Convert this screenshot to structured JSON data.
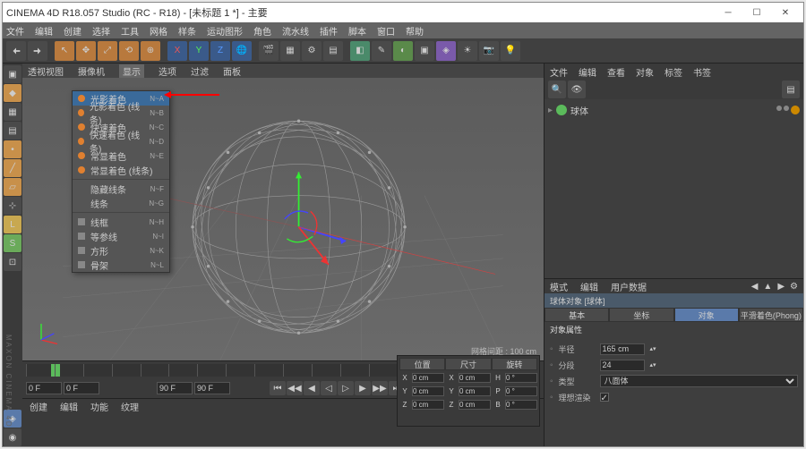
{
  "title": "CINEMA 4D R18.057 Studio (RC - R18) - [未标题 1 *] - 主要",
  "menus": [
    "文件",
    "编辑",
    "创建",
    "选择",
    "工具",
    "网格",
    "样条",
    "运动图形",
    "角色",
    "流水线",
    "插件",
    "脚本",
    "窗口",
    "帮助"
  ],
  "vp_tabs": [
    "透视视图",
    "摄像机",
    "显示",
    "选项",
    "过滤",
    "面板"
  ],
  "vp_status": "网格间距 : 100 cm",
  "dropdown": [
    {
      "label": "光影着色",
      "short": "N~A",
      "icon": "dot",
      "sel": true
    },
    {
      "label": "光影着色 (线条)",
      "short": "N~B",
      "icon": "dot"
    },
    {
      "label": "快速着色",
      "short": "N~C",
      "icon": "dot"
    },
    {
      "label": "快速着色 (线条)",
      "short": "N~D",
      "icon": "dot"
    },
    {
      "label": "常显着色",
      "short": "N~E",
      "icon": "dot"
    },
    {
      "label": "常显着色 (线条)",
      "short": "",
      "icon": "dot"
    },
    {
      "sep": true
    },
    {
      "label": "隐藏线条",
      "short": "N~F",
      "icon": ""
    },
    {
      "label": "线条",
      "short": "N~G",
      "icon": ""
    },
    {
      "sep": true
    },
    {
      "label": "线框",
      "short": "N~H",
      "icon": "sq"
    },
    {
      "label": "等参线",
      "short": "N~I",
      "icon": "sq"
    },
    {
      "label": "方形",
      "short": "N~K",
      "icon": "sq"
    },
    {
      "label": "骨架",
      "short": "N~L",
      "icon": "sq"
    }
  ],
  "timeline": {
    "start": "0",
    "end": "90",
    "frame": "0 F",
    "frame2": "0 F",
    "endframe": "90 F",
    "endframe2": "90 F"
  },
  "bottom_tabs": [
    "创建",
    "编辑",
    "功能",
    "纹理"
  ],
  "right_top": [
    "文件",
    "编辑",
    "查看",
    "对象",
    "标签",
    "书签"
  ],
  "tree_item": "球体",
  "attr_top": [
    "模式",
    "编辑",
    "用户数据"
  ],
  "obj_header": "球体对象 [球体]",
  "attr_tabs": [
    "基本",
    "坐标",
    "对象",
    "平滑着色(Phong)"
  ],
  "props_title": "对象属性",
  "props": {
    "radius_label": "半径",
    "radius": "165 cm",
    "seg_label": "分段",
    "seg": "24",
    "type_label": "类型",
    "type": "八面体",
    "render_label": "理想渲染"
  },
  "coord_tabs": [
    "位置",
    "尺寸",
    "旋转"
  ],
  "coords": {
    "x": "0 cm",
    "y": "0 cm",
    "z": "0 cm",
    "sx": "0 cm",
    "sy": "0 cm",
    "sz": "0 cm",
    "rh": "0 °",
    "rp": "0 °",
    "rb": "0 °"
  },
  "brand": "MAXON CINEMA 4D"
}
